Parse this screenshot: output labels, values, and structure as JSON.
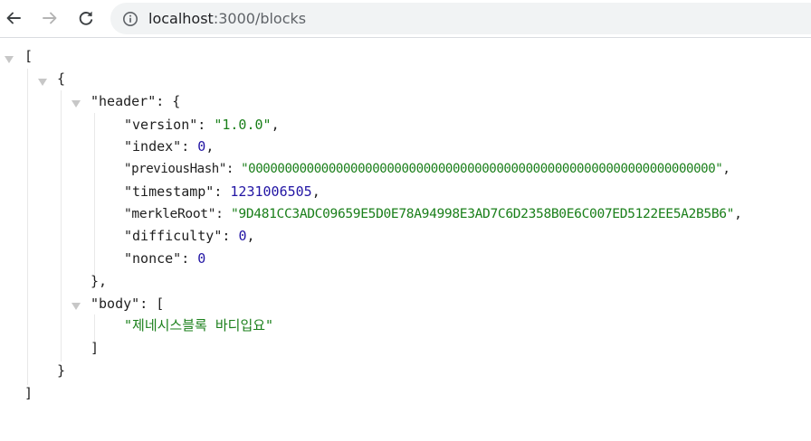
{
  "browser": {
    "url_host": "localhost",
    "url_path": ":3000/blocks"
  },
  "json": {
    "open_array": "[",
    "close_array": "]",
    "open_object": "{",
    "close_object": "}",
    "header_key": "\"header\"",
    "header_open": ": {",
    "header_close": "},",
    "body_key": "\"body\"",
    "body_open": ": [",
    "body_close": "]",
    "fields": [
      {
        "key": "\"version\"",
        "sep": ": ",
        "value": "\"1.0.0\"",
        "type": "string",
        "trail": ","
      },
      {
        "key": "\"index\"",
        "sep": ": ",
        "value": "0",
        "type": "number",
        "trail": ","
      },
      {
        "key": "\"previousHash\"",
        "sep": ": ",
        "value": "\"0000000000000000000000000000000000000000000000000000000000000000\"",
        "type": "string",
        "trail": ","
      },
      {
        "key": "\"timestamp\"",
        "sep": ": ",
        "value": "1231006505",
        "type": "number",
        "trail": ","
      },
      {
        "key": "\"merkleRoot\"",
        "sep": ": ",
        "value": "\"9D481CC3ADC09659E5D0E78A94998E3AD7C6D2358B0E6C007ED5122EE5A2B5B6\"",
        "type": "string",
        "trail": ","
      },
      {
        "key": "\"difficulty\"",
        "sep": ": ",
        "value": "0",
        "type": "number",
        "trail": ","
      },
      {
        "key": "\"nonce\"",
        "sep": ": ",
        "value": "0",
        "type": "number",
        "trail": ""
      }
    ],
    "body_items": [
      "\"제네시스블록 바디입요\""
    ]
  },
  "colors": {
    "string": "#1a7f1a",
    "number": "#2215a4",
    "triangle": "#c7c7c7"
  },
  "icons": {
    "back": "back-arrow-icon",
    "forward": "forward-arrow-icon",
    "reload": "reload-icon",
    "info": "info-circle-icon",
    "collapse": "collapse-triangle-icon"
  }
}
